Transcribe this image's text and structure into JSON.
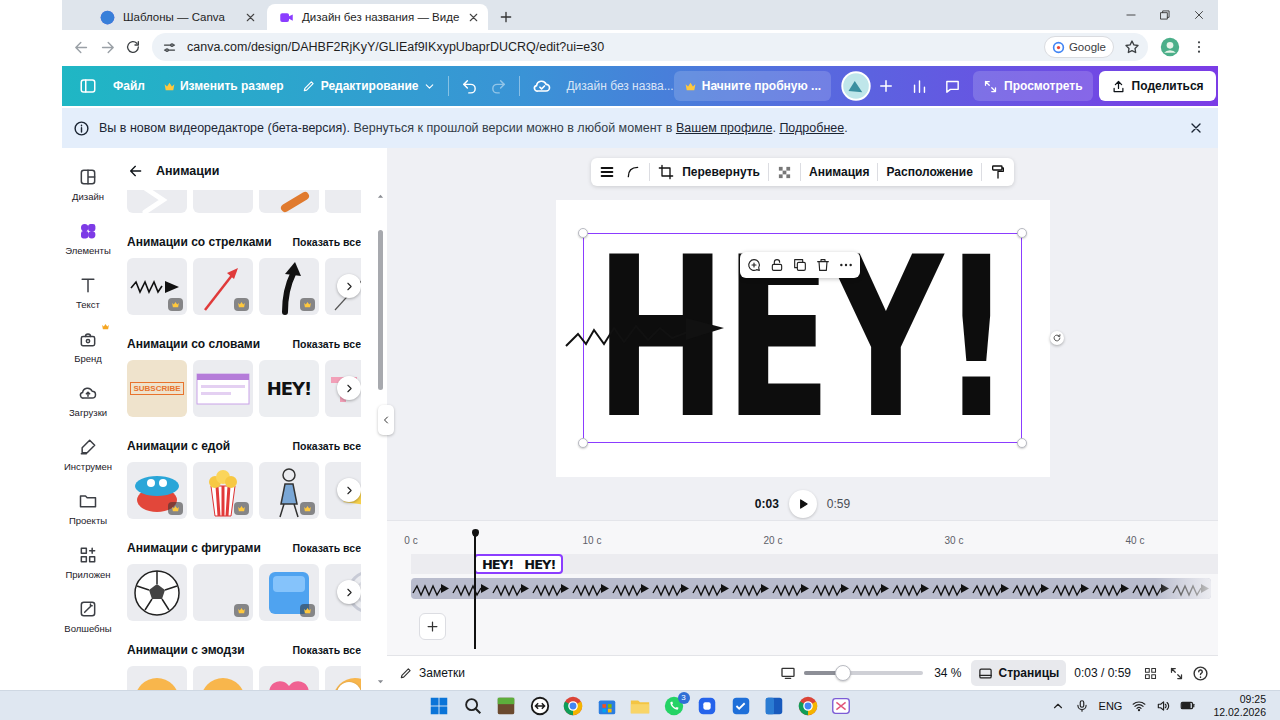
{
  "browser": {
    "tabs": [
      {
        "label": "Шаблоны — Canva",
        "selected": false
      },
      {
        "label": "Дизайн без названия — Виде",
        "selected": true
      }
    ],
    "url": "canva.com/design/DAHBF2RjKyY/GLIEaf9IKxypUbaprDUCRQ/edit?ui=e30",
    "lens": "Google"
  },
  "topbar": {
    "file": "Файл",
    "resize": "Изменить размер",
    "editing": "Редактирование",
    "undo_enabled": true,
    "redo_enabled": false,
    "title": "Дизайн без назва...",
    "trial": "Начните пробную ...",
    "preview": "Просмотреть",
    "share": "Поделиться"
  },
  "banner": {
    "segments": [
      {
        "text": "Вы в новом видеоредакторе (бета-версия).",
        "kind": "bold"
      },
      {
        "text": " Вернуться к прошлой версии можно в любой момент в ",
        "kind": "plain"
      },
      {
        "text": "Вашем профиле",
        "kind": "link"
      },
      {
        "text": ". ",
        "kind": "plain"
      },
      {
        "text": "Подробнее",
        "kind": "link"
      },
      {
        "text": ".",
        "kind": "plain"
      }
    ]
  },
  "rail": [
    {
      "label": "Дизайн",
      "selected": false,
      "crown": false
    },
    {
      "label": "Элементы",
      "selected": true,
      "crown": false
    },
    {
      "label": "Текст",
      "selected": false,
      "crown": false
    },
    {
      "label": "Бренд",
      "selected": false,
      "crown": true
    },
    {
      "label": "Загрузки",
      "selected": false,
      "crown": false
    },
    {
      "label": "Инструмен",
      "selected": false,
      "crown": false
    },
    {
      "label": "Проекты",
      "selected": false,
      "crown": false
    },
    {
      "label": "Приложен",
      "selected": false,
      "crown": false
    },
    {
      "label": "Волшебны",
      "selected": false,
      "crown": false
    }
  ],
  "panel": {
    "title": "Анимации",
    "scroll_position": 0.08,
    "top_row": [
      {
        "kind": "chevron",
        "premium": false
      },
      {
        "kind": "blank",
        "premium": false
      },
      {
        "kind": "stroke",
        "premium": false
      },
      {
        "kind": "blank",
        "premium": false
      }
    ],
    "sections": [
      {
        "title": "Анимации со стрелками",
        "more": "Показать все",
        "thumbs": [
          {
            "kind": "scribble-arrow",
            "premium": true
          },
          {
            "kind": "red-arrow",
            "premium": true
          },
          {
            "kind": "curl-arrow",
            "premium": true
          },
          {
            "kind": "line",
            "premium": false
          }
        ]
      },
      {
        "title": "Анимации со словами",
        "more": "Показать все",
        "thumbs": [
          {
            "kind": "subscribe",
            "premium": false,
            "label": "SUBSCRIBE"
          },
          {
            "kind": "window",
            "premium": false
          },
          {
            "kind": "word",
            "premium": false,
            "label": "HEY!"
          },
          {
            "kind": "partial-word",
            "premium": false
          }
        ]
      },
      {
        "title": "Анимации с едой",
        "more": "Показать все",
        "thumbs": [
          {
            "kind": "food-bowl",
            "premium": true
          },
          {
            "kind": "popcorn",
            "premium": true
          },
          {
            "kind": "person",
            "premium": true
          },
          {
            "kind": "cheese",
            "premium": false
          }
        ]
      },
      {
        "title": "Анимации с фигурами",
        "more": "Показать все",
        "thumbs": [
          {
            "kind": "ball",
            "premium": false
          },
          {
            "kind": "blank",
            "premium": true
          },
          {
            "kind": "cube",
            "premium": true
          },
          {
            "kind": "ring",
            "premium": false
          }
        ]
      },
      {
        "title": "Анимации с эмодзи",
        "more": "Показать все",
        "thumbs": [
          {
            "kind": "emoji",
            "premium": false
          },
          {
            "kind": "emoji",
            "premium": false
          },
          {
            "kind": "emoji-heart",
            "premium": false
          },
          {
            "kind": "emoji",
            "premium": false
          }
        ]
      }
    ]
  },
  "toolbar": {
    "flip": "Перевернуть",
    "animate": "Анимация",
    "position": "Расположение"
  },
  "design": {
    "graphic": "HEY!",
    "selected": true
  },
  "playback": {
    "current": "0:03",
    "total": "0:59",
    "playing": false
  },
  "timeline": {
    "ticks": [
      {
        "label": "0 с",
        "seconds": 0
      },
      {
        "label": "10 с",
        "seconds": 10
      },
      {
        "label": "20 с",
        "seconds": 20
      },
      {
        "label": "30 с",
        "seconds": 30
      },
      {
        "label": "40 с",
        "seconds": 40
      }
    ],
    "playhead_s": 3.5,
    "tracks": [
      {
        "kind": "clip",
        "frames": [
          "HEY!",
          "HEY!"
        ],
        "start_s": 3.5,
        "end_s": 8.4,
        "selected": true
      },
      {
        "kind": "arrows",
        "start_s": 0,
        "end_s": 44.2,
        "selected": false
      }
    ]
  },
  "bottom": {
    "notes": "Заметки",
    "zoom": "34 %",
    "zoom_level": 0.33,
    "pages": "Страницы",
    "pages_selected": true,
    "time": "0:03 / 0:59"
  },
  "taskbar": {
    "whatsapp_badge": "3",
    "lang": "ENG",
    "time": "09:25",
    "date": "12.02.2026"
  }
}
